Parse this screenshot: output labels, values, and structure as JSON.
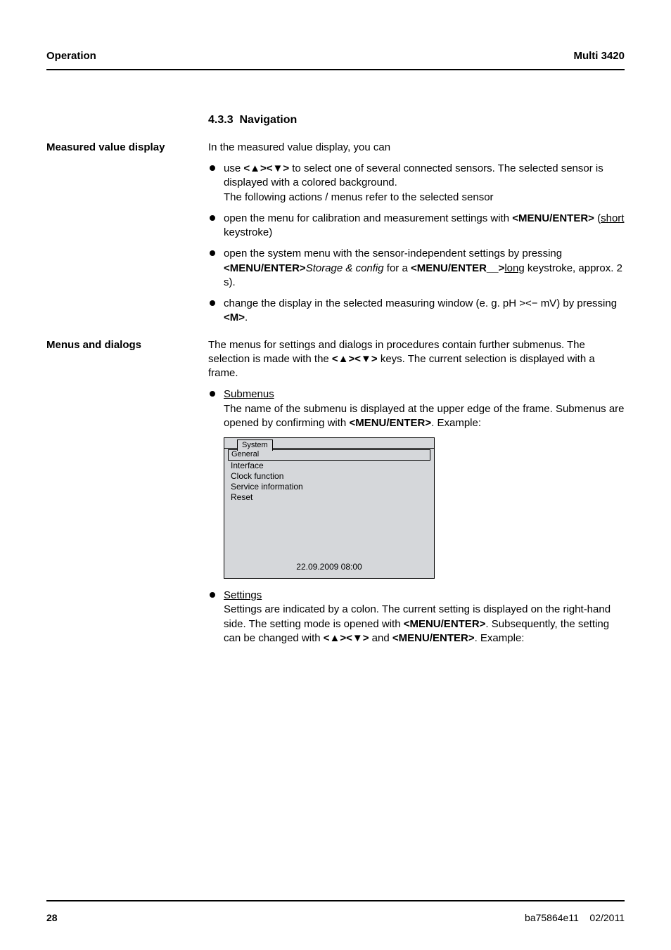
{
  "header": {
    "left": "Operation",
    "right": "Multi 3420"
  },
  "section": {
    "number": "4.3.3",
    "title": "Navigation"
  },
  "measured": {
    "side": "Measured value display",
    "intro": "In the measured value display, you can",
    "b1": {
      "pre": "use ",
      "keys": "<▲><▼>",
      "post1": " to select one of several connected sensors. The selected sensor is displayed with a colored background.",
      "post2": "The following actions / menus refer to the selected sensor"
    },
    "b2": {
      "pre": "open the menu for calibration and measurement settings with ",
      "key": "<MENU/ENTER>",
      "paren_open": " (",
      "short": "short",
      "paren_close": " keystroke)"
    },
    "b3": {
      "line1_a": "open the system menu with the sensor-independent settings by pressing ",
      "key1": "<MENU/ENTER>",
      "ital": "Storage & config",
      "line1_b": " for a ",
      "key2": "<MENU/ENTER__>",
      "long": "long",
      "line1_c": " keystroke, approx. 2 s)."
    },
    "b4": {
      "pre": "change the display in the selected measuring window (e. g. pH ><− mV) by pressing ",
      "key": "<M>",
      "post": "."
    }
  },
  "menus": {
    "side": "Menus and dialogs",
    "intro_a": "The menus for settings and dialogs in procedures contain further submenus. The selection is made with the ",
    "keys": "<▲><▼>",
    "intro_b": " keys. The current selection is displayed with a frame.",
    "b1": {
      "title": "Submenus",
      "line_a": "The name of the submenu is displayed at the upper edge of the frame. Submenus are opened by confirming with ",
      "key": "<MENU/ENTER>",
      "line_b": ". Example:"
    },
    "device": {
      "tab": "System",
      "items": [
        "General",
        "Interface",
        "Clock function",
        "Service information",
        "Reset"
      ],
      "status": "22.09.2009 08:00"
    },
    "b2": {
      "title": "Settings",
      "line_a": "Settings are indicated by a colon. The current setting is displayed on the right-hand side. The setting mode is opened with ",
      "key1": "<MENU/ENTER>",
      "line_b": ". Subsequently, the setting can be changed with ",
      "keys2": "<▲><▼>",
      "line_c": " and ",
      "key3": "<MENU/ENTER>",
      "line_d": ". Example:"
    }
  },
  "footer": {
    "page": "28",
    "doc": "ba75864e11",
    "date": "02/2011"
  }
}
